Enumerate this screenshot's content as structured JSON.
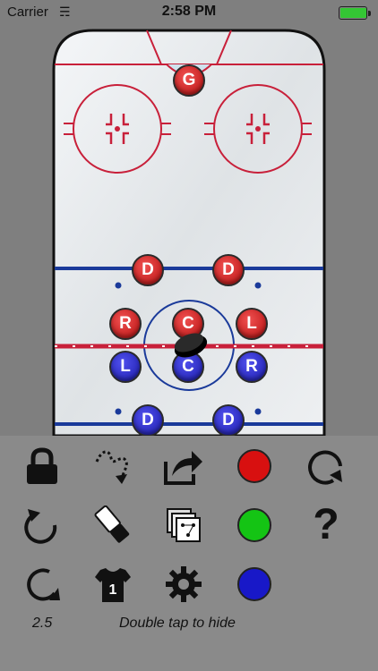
{
  "status_bar": {
    "carrier": "Carrier",
    "time": "2:58 PM",
    "battery_level": 0.95
  },
  "rink": {
    "goalie_label": "G",
    "players": [
      {
        "label": "D",
        "team": "red"
      },
      {
        "label": "D",
        "team": "red"
      },
      {
        "label": "R",
        "team": "red"
      },
      {
        "label": "C",
        "team": "red"
      },
      {
        "label": "L",
        "team": "red"
      },
      {
        "label": "L",
        "team": "blue"
      },
      {
        "label": "C",
        "team": "blue"
      },
      {
        "label": "R",
        "team": "blue"
      },
      {
        "label": "D",
        "team": "blue"
      },
      {
        "label": "D",
        "team": "blue"
      }
    ]
  },
  "toolbar": {
    "icons": [
      "lock-icon",
      "trail-path-icon",
      "share-icon",
      "red-color",
      "rotate-icon",
      "undo-icon",
      "eraser-icon",
      "plays-icon",
      "green-color",
      "help-icon",
      "redo-icon",
      "jersey-icon",
      "settings-icon",
      "blue-color"
    ],
    "jersey_number": "1",
    "colors": {
      "red": "#d81010",
      "green": "#14c414",
      "blue": "#1818c8"
    },
    "speed_value": "2.5",
    "hide_hint": "Double tap to hide"
  }
}
